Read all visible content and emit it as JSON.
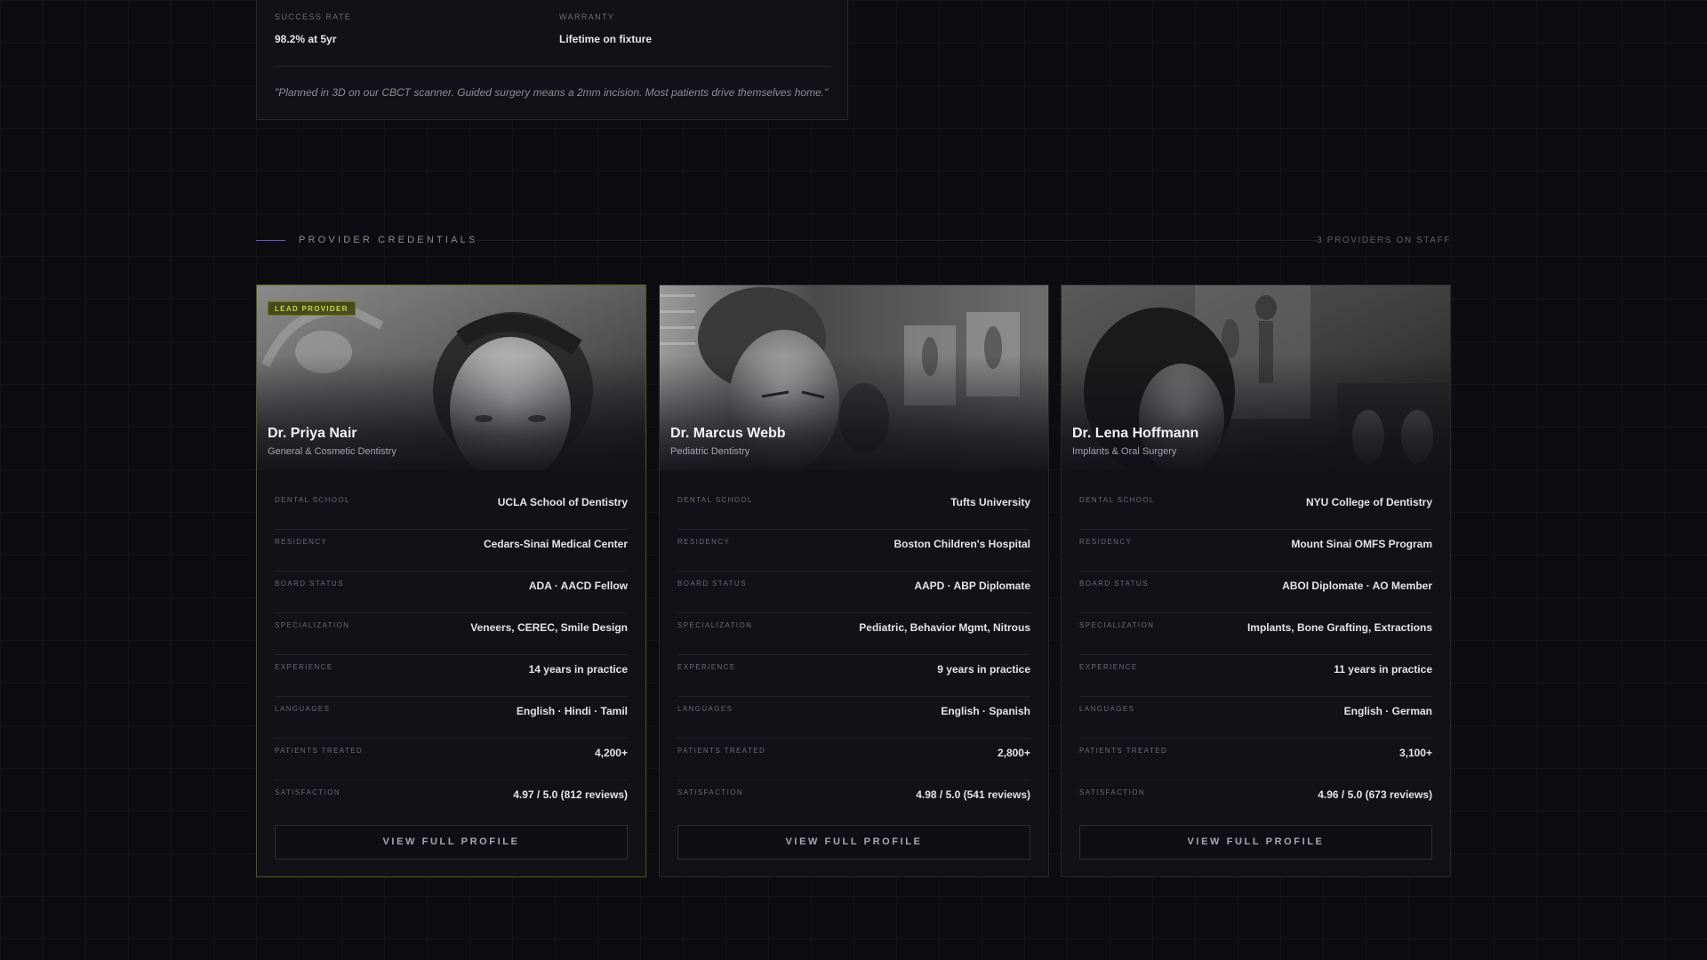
{
  "procedure": {
    "stats": [
      {
        "label": "SUCCESS RATE",
        "value": "98.2% at 5yr"
      },
      {
        "label": "WARRANTY",
        "value": "Lifetime on fixture"
      }
    ],
    "quote": "\"Planned in 3D on our CBCT scanner. Guided surgery means a 2mm incision. Most patients drive themselves home.\""
  },
  "section": {
    "title": "PROVIDER CREDENTIALS",
    "count": "3 PROVIDERS ON STAFF"
  },
  "colors": {
    "background": "#0d0d11",
    "card": "#111116",
    "accent_purple": "#6a55c9",
    "lead_accent": "#c8d63a"
  },
  "providers": [
    {
      "badge": "LEAD PROVIDER",
      "name": "Dr. Priya Nair",
      "specialty": "General & Cosmetic Dentistry",
      "credentials": [
        {
          "label": "DENTAL SCHOOL",
          "value": "UCLA School of Dentistry"
        },
        {
          "label": "RESIDENCY",
          "value": "Cedars-Sinai Medical Center"
        },
        {
          "label": "BOARD STATUS",
          "value": "ADA · AACD Fellow"
        },
        {
          "label": "SPECIALIZATION",
          "value": "Veneers, CEREC, Smile Design"
        },
        {
          "label": "EXPERIENCE",
          "value": "14 years in practice"
        },
        {
          "label": "LANGUAGES",
          "value": "English · Hindi · Tamil"
        },
        {
          "label": "PATIENTS TREATED",
          "value": "4,200+"
        },
        {
          "label": "SATISFACTION",
          "value": "4.97 / 5.0 (812 reviews)"
        }
      ],
      "button_label": "VIEW FULL PROFILE"
    },
    {
      "name": "Dr. Marcus Webb",
      "specialty": "Pediatric Dentistry",
      "credentials": [
        {
          "label": "DENTAL SCHOOL",
          "value": "Tufts University"
        },
        {
          "label": "RESIDENCY",
          "value": "Boston Children's Hospital"
        },
        {
          "label": "BOARD STATUS",
          "value": "AAPD · ABP Diplomate"
        },
        {
          "label": "SPECIALIZATION",
          "value": "Pediatric, Behavior Mgmt, Nitrous"
        },
        {
          "label": "EXPERIENCE",
          "value": "9 years in practice"
        },
        {
          "label": "LANGUAGES",
          "value": "English · Spanish"
        },
        {
          "label": "PATIENTS TREATED",
          "value": "2,800+"
        },
        {
          "label": "SATISFACTION",
          "value": "4.98 / 5.0 (541 reviews)"
        }
      ],
      "button_label": "VIEW FULL PROFILE"
    },
    {
      "name": "Dr. Lena Hoffmann",
      "specialty": "Implants & Oral Surgery",
      "credentials": [
        {
          "label": "DENTAL SCHOOL",
          "value": "NYU College of Dentistry"
        },
        {
          "label": "RESIDENCY",
          "value": "Mount Sinai OMFS Program"
        },
        {
          "label": "BOARD STATUS",
          "value": "ABOI Diplomate · AO Member"
        },
        {
          "label": "SPECIALIZATION",
          "value": "Implants, Bone Grafting, Extractions"
        },
        {
          "label": "EXPERIENCE",
          "value": "11 years in practice"
        },
        {
          "label": "LANGUAGES",
          "value": "English · German"
        },
        {
          "label": "PATIENTS TREATED",
          "value": "3,100+"
        },
        {
          "label": "SATISFACTION",
          "value": "4.96 / 5.0 (673 reviews)"
        }
      ],
      "button_label": "VIEW FULL PROFILE"
    }
  ]
}
